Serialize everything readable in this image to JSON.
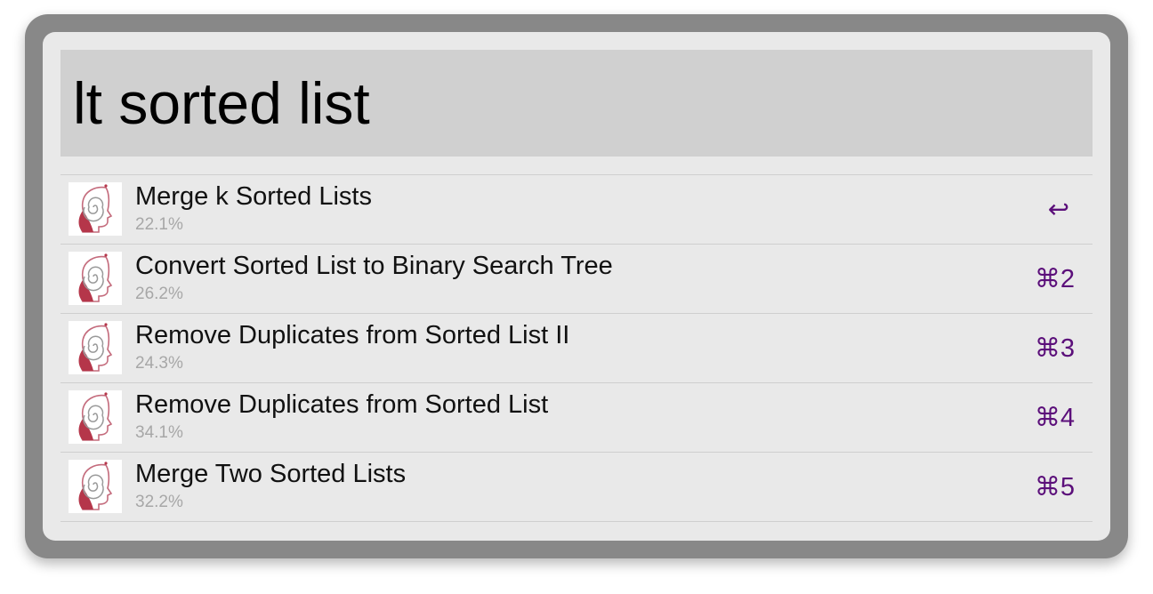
{
  "query": {
    "text": "lt sorted list"
  },
  "results": [
    {
      "title": "Merge k Sorted Lists",
      "subtitle": "22.1%",
      "shortcut": "↩",
      "icon": "leetcode-head-spiral-icon"
    },
    {
      "title": "Convert Sorted List to Binary Search Tree",
      "subtitle": "26.2%",
      "shortcut": "⌘2",
      "icon": "leetcode-head-spiral-icon"
    },
    {
      "title": "Remove Duplicates from Sorted List II",
      "subtitle": "24.3%",
      "shortcut": "⌘3",
      "icon": "leetcode-head-spiral-icon"
    },
    {
      "title": "Remove Duplicates from Sorted List",
      "subtitle": "34.1%",
      "shortcut": "⌘4",
      "icon": "leetcode-head-spiral-icon"
    },
    {
      "title": "Merge Two Sorted Lists",
      "subtitle": "32.2%",
      "shortcut": "⌘5",
      "icon": "leetcode-head-spiral-icon"
    }
  ],
  "colors": {
    "frame": "#888888",
    "panel": "#e9e9e9",
    "query_background": "#d0d0d0",
    "shortcut": "#5b0f7a",
    "subtitle": "#a7a7a7",
    "icon_accent": "#b5364a"
  }
}
